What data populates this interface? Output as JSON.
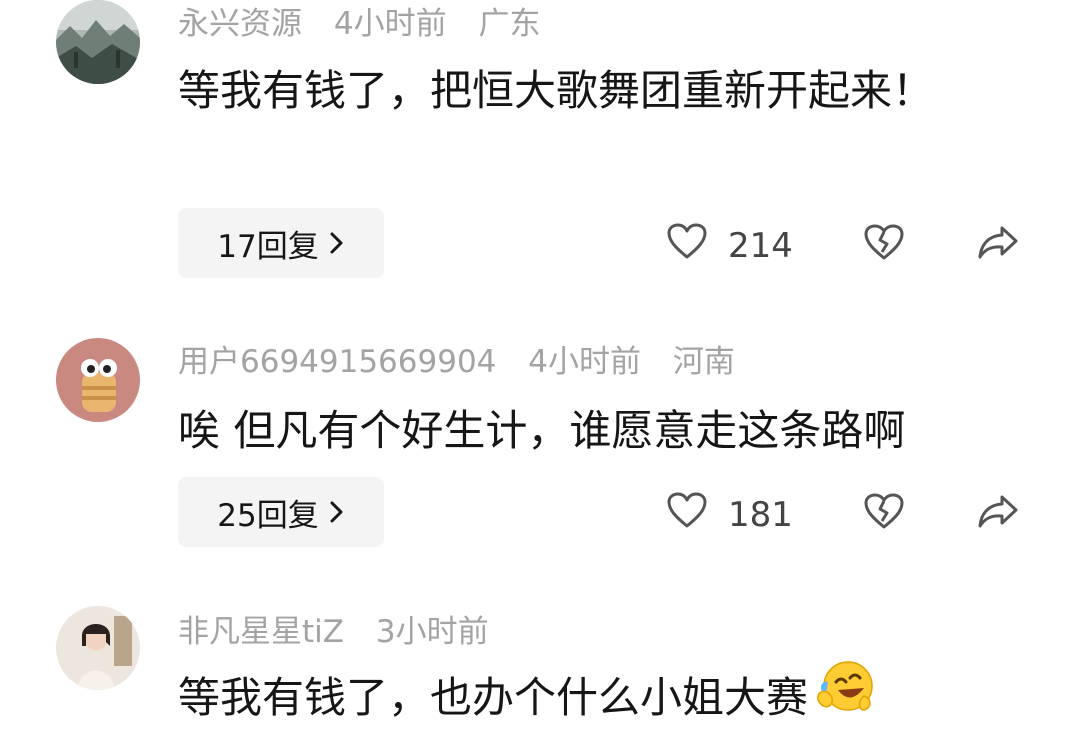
{
  "comments": [
    {
      "username": "永兴资源",
      "time": "4小时前",
      "location": "广东",
      "text": "等我有钱了，把恒大歌舞团重新开起来！",
      "reply_label": "17回复",
      "likes": "214"
    },
    {
      "username": "用户6694915669904",
      "time": "4小时前",
      "location": "河南",
      "text": "唉 但凡有个好生计，谁愿意走这条路啊",
      "reply_label": "25回复",
      "likes": "181"
    },
    {
      "username": "非凡星星tiZ",
      "time": "3小时前",
      "location": "",
      "text": "等我有钱了，也办个什么小姐大赛",
      "emoji": "crying-laughing-emoji"
    }
  ],
  "icons": {
    "like": "heart-icon",
    "dislike": "broken-heart-icon",
    "share": "share-arrow-icon",
    "chevron": "chevron-right-icon"
  },
  "colors": {
    "meta": "#a3a3a3",
    "text": "#161616",
    "reply_bg": "#f4f4f4",
    "icon": "#555555"
  }
}
